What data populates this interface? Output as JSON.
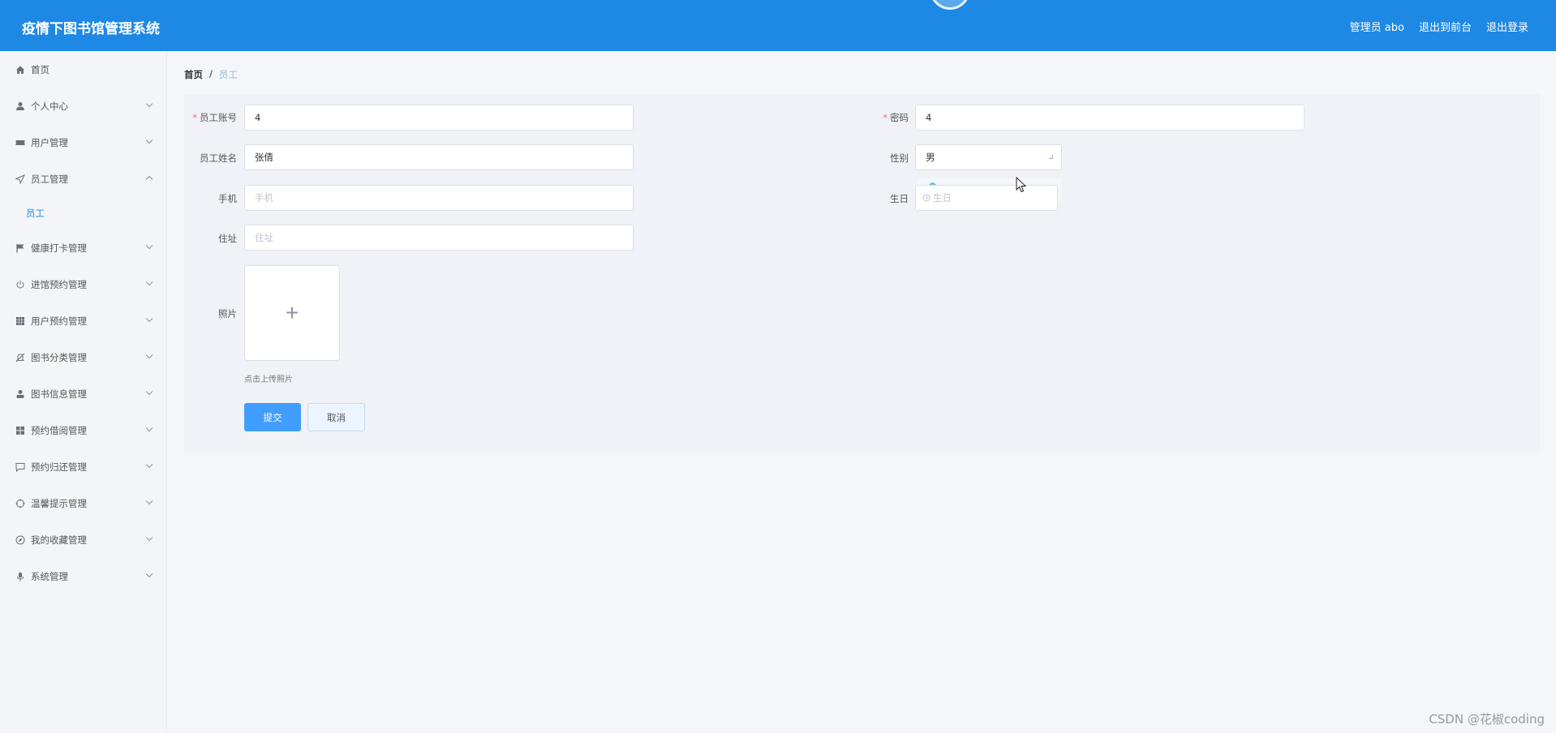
{
  "header": {
    "app_title": "疫情下图书馆管理系统",
    "user_label": "管理员 abo",
    "to_front": "退出到前台",
    "logout": "退出登录"
  },
  "sidebar": {
    "items": [
      {
        "label": "首页",
        "icon": "home-icon",
        "chevron": "none"
      },
      {
        "label": "个人中心",
        "icon": "user-icon",
        "chevron": "down"
      },
      {
        "label": "用户管理",
        "icon": "ticket-icon",
        "chevron": "down"
      },
      {
        "label": "员工管理",
        "icon": "send-icon",
        "chevron": "up"
      },
      {
        "label": "健康打卡管理",
        "icon": "flag-icon",
        "chevron": "down"
      },
      {
        "label": "进馆预约管理",
        "icon": "power-icon",
        "chevron": "down"
      },
      {
        "label": "用户预约管理",
        "icon": "grid-icon",
        "chevron": "down"
      },
      {
        "label": "图书分类管理",
        "icon": "bell-off-icon",
        "chevron": "down"
      },
      {
        "label": "图书信息管理",
        "icon": "person-icon",
        "chevron": "down"
      },
      {
        "label": "预约借阅管理",
        "icon": "apps-icon",
        "chevron": "down"
      },
      {
        "label": "预约归还管理",
        "icon": "chat-icon",
        "chevron": "down"
      },
      {
        "label": "温馨提示管理",
        "icon": "aim-icon",
        "chevron": "down"
      },
      {
        "label": "我的收藏管理",
        "icon": "compass-icon",
        "chevron": "down"
      },
      {
        "label": "系统管理",
        "icon": "mic-icon",
        "chevron": "down"
      }
    ],
    "sub_item": "员工"
  },
  "breadcrumb": {
    "home": "首页",
    "sep": "/",
    "current": "员工"
  },
  "form": {
    "account_label": "员工账号",
    "account_value": "4",
    "password_label": "密码",
    "password_value": "4",
    "name_label": "员工姓名",
    "name_value": "张倩",
    "gender_label": "性别",
    "gender_value": "男",
    "phone_label": "手机",
    "phone_placeholder": "手机",
    "birthday_label": "生日",
    "birthday_placeholder": "生日",
    "address_label": "住址",
    "address_placeholder": "住址",
    "photo_label": "照片",
    "upload_plus": "+",
    "upload_tip": "点击上传照片",
    "required_mark": "*"
  },
  "buttons": {
    "submit": "提交",
    "cancel": "取消"
  },
  "watermark": "CSDN @花椒coding",
  "colors": {
    "header": "#1e88e5",
    "primary": "#409eff",
    "required": "#f56c6c"
  }
}
